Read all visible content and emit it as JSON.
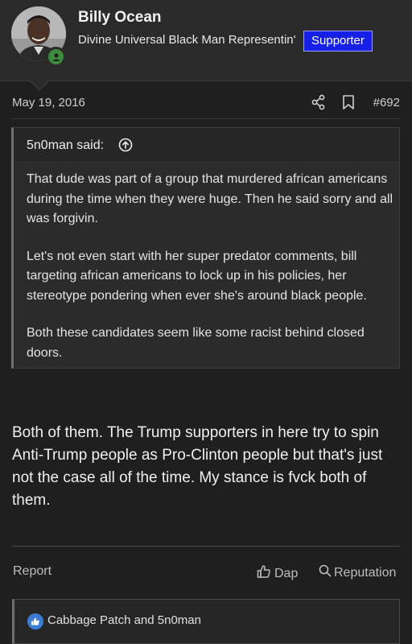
{
  "post": {
    "author": "Billy Ocean",
    "user_title": "Divine Universal Black Man Representin'",
    "badge": "Supporter",
    "date": "May 19, 2016",
    "post_number": "#692",
    "quote": {
      "author_line": "5n0man said:",
      "paragraphs": [
        "That dude was part of a group that murdered african americans during the time when they were huge. Then he said sorry and all was forgivin.",
        "Let's not even start with her super predator comments, bill targeting african americans to lock up in his policies, her stereotype pondering when ever she's around black people.",
        "Both these candidates seem like some racist behind closed doors."
      ]
    },
    "message": "Both of them. The Trump supporters in here try to spin Anti-Trump people as Pro-Clinton people but that's just not the case all of the time. My stance is fvck both of them."
  },
  "actions": {
    "report": "Report",
    "dap": "Dap",
    "reputation": "Reputation"
  },
  "reactions": {
    "users": "Cabbage Patch and 5n0man"
  },
  "icons": {
    "share": "share-icon",
    "bookmark": "bookmark-icon",
    "quote_jump": "arrow-up-circle-icon",
    "like": "thumbs-up-icon",
    "search": "search-icon",
    "online": "user-online-icon"
  },
  "colors": {
    "badge_bg": "#1620e8",
    "online": "#3c8a3c",
    "reaction_icon": "#3a7bd5"
  }
}
